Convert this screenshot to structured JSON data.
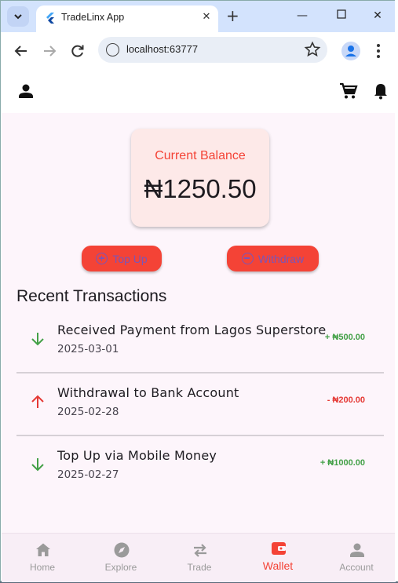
{
  "browser": {
    "tab_title": "TradeLinx App",
    "url": "localhost:63777"
  },
  "wallet": {
    "balance_label": "Current Balance",
    "balance_value": "₦1250.50",
    "topup_label": "Top Up",
    "withdraw_label": "Withdraw",
    "section_title": "Recent Transactions",
    "transactions": [
      {
        "title": "Received Payment from Lagos Superstore",
        "date": "2025-03-01",
        "amount": "+ ₦500.00",
        "type": "credit"
      },
      {
        "title": "Withdrawal to Bank Account",
        "date": "2025-02-28",
        "amount": "- ₦200.00",
        "type": "debit"
      },
      {
        "title": "Top Up via Mobile Money",
        "date": "2025-02-27",
        "amount": "+ ₦1000.00",
        "type": "credit"
      }
    ]
  },
  "nav": {
    "items": [
      {
        "label": "Home",
        "icon": "home-icon"
      },
      {
        "label": "Explore",
        "icon": "explore-icon"
      },
      {
        "label": "Trade",
        "icon": "swap-icon"
      },
      {
        "label": "Wallet",
        "icon": "wallet-icon",
        "active": true
      },
      {
        "label": "Account",
        "icon": "person-icon"
      }
    ]
  },
  "colors": {
    "accent": "#f44336",
    "credit": "#43a047",
    "debit": "#e53935",
    "app_bg": "#fdf5fb"
  }
}
